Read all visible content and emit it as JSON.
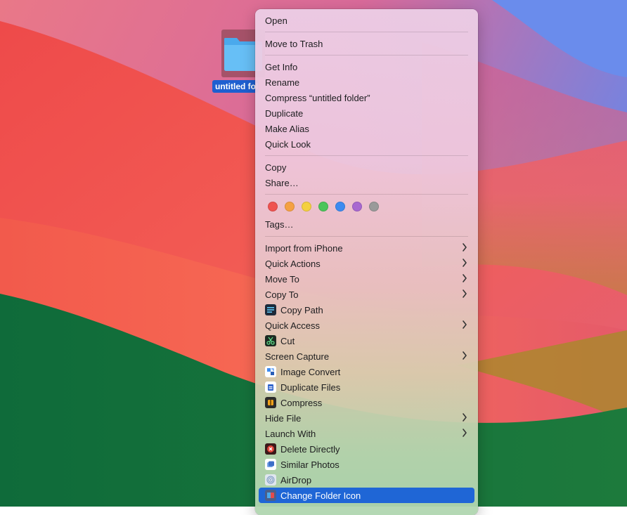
{
  "desktop": {
    "folder_label": "untitled folder"
  },
  "menu": {
    "open": "Open",
    "move_to_trash": "Move to Trash",
    "get_info": "Get Info",
    "rename": "Rename",
    "compress": "Compress “untitled folder”",
    "duplicate": "Duplicate",
    "make_alias": "Make Alias",
    "quick_look": "Quick Look",
    "copy": "Copy",
    "share": "Share…",
    "tags_label": "Tags…",
    "tag_colors": [
      "#ef5350",
      "#f5a142",
      "#f4d03f",
      "#4cc55a",
      "#3d8bf0",
      "#a868d0",
      "#9a9a9a"
    ],
    "import_from_iphone": "Import from iPhone",
    "quick_actions": "Quick Actions",
    "move_to": "Move To",
    "copy_to": "Copy To",
    "copy_path": "Copy Path",
    "quick_access": "Quick Access",
    "cut": "Cut",
    "screen_capture": "Screen Capture",
    "image_convert": "Image Convert",
    "duplicate_files": "Duplicate Files",
    "compress_ext": "Compress",
    "hide_file": "Hide File",
    "launch_with": "Launch With",
    "delete_directly": "Delete Directly",
    "similar_photos": "Similar Photos",
    "airdrop": "AirDrop",
    "change_folder_icon": "Change Folder Icon"
  }
}
